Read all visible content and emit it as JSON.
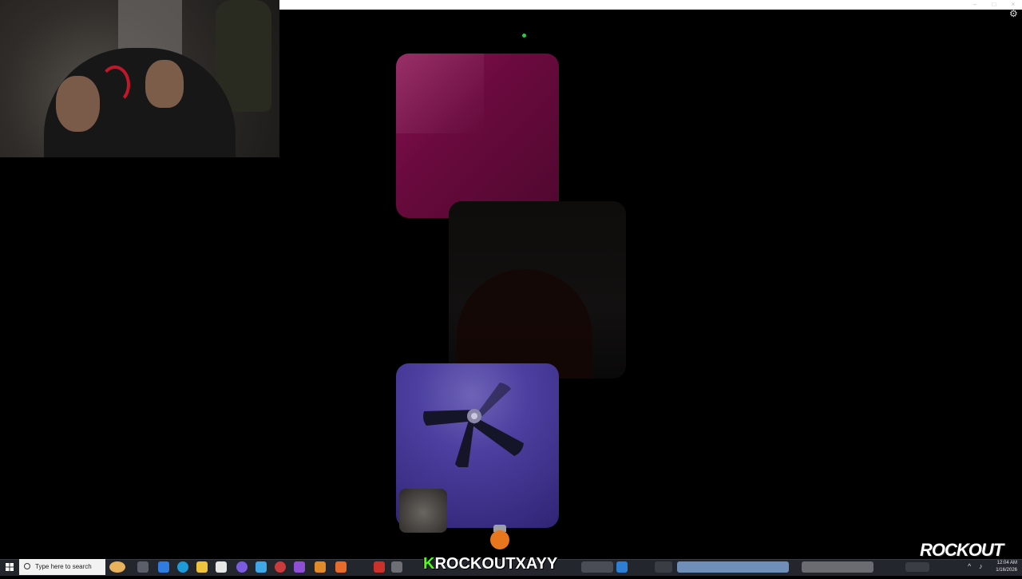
{
  "webcam": {
    "label": ""
  },
  "taskbar": {
    "search_placeholder": "Type here to search",
    "channel_banner": {
      "k_letter": "K",
      "text": "ROCKOUTXAYY"
    },
    "clock": {
      "time": "12:04 AM",
      "date": "1/16/2026"
    }
  },
  "logo": {
    "text": "ROCKOUT"
  },
  "colors": {
    "tile_pink": "#7a0f48",
    "tile_dark": "#100e0c",
    "tile_purple": "#4c3fa0",
    "status_dot": "#2ec84a",
    "kick_green": "#53fc18",
    "taskbar_bg": "#23262d"
  },
  "icons": [
    "windows-start-icon",
    "search-icon",
    "task-view-icon",
    "settings-gear-icon",
    "fan-icon"
  ]
}
